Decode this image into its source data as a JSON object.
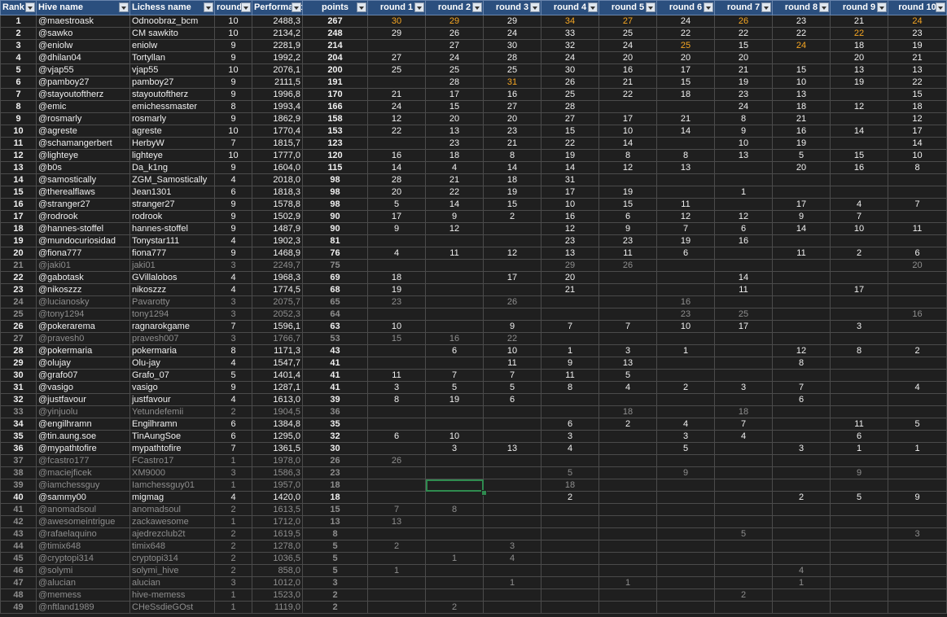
{
  "headers": {
    "rank": "Rank",
    "hive": "Hive name",
    "lichess": "Lichess name",
    "rounds": "rounds",
    "perf": "Performance",
    "points": "points",
    "round_labels": [
      "round 1",
      "round 2",
      "round 3",
      "round 4",
      "round 5",
      "round 6",
      "round 7",
      "round 8",
      "round 9",
      "round 10"
    ]
  },
  "highlight_color": "#f5a623",
  "header_bg": "#2b4f7e",
  "rows": [
    {
      "rank": "1",
      "hive": "@maestroask",
      "lichess": "Odnoobraz_bcm",
      "rounds": "10",
      "perf": "2488,3",
      "points": "267",
      "r": [
        "30",
        "29",
        "29",
        "34",
        "27",
        "24",
        "26",
        "23",
        "21",
        "24"
      ],
      "hl": [
        0,
        1,
        3,
        4,
        6,
        9
      ],
      "dim": false
    },
    {
      "rank": "2",
      "hive": "@sawko",
      "lichess": "CM sawkito",
      "rounds": "10",
      "perf": "2134,2",
      "points": "248",
      "r": [
        "29",
        "26",
        "24",
        "33",
        "25",
        "22",
        "22",
        "22",
        "22",
        "23"
      ],
      "hl": [
        8
      ],
      "dim": false
    },
    {
      "rank": "3",
      "hive": "@eniolw",
      "lichess": "eniolw",
      "rounds": "9",
      "perf": "2281,9",
      "points": "214",
      "r": [
        "",
        "27",
        "30",
        "32",
        "24",
        "25",
        "15",
        "24",
        "18",
        "19"
      ],
      "hl": [
        5,
        7
      ],
      "dim": false
    },
    {
      "rank": "4",
      "hive": "@dhilan04",
      "lichess": "Tortyllan",
      "rounds": "9",
      "perf": "1992,2",
      "points": "204",
      "r": [
        "27",
        "24",
        "28",
        "24",
        "20",
        "20",
        "20",
        "",
        "20",
        "21"
      ],
      "hl": [],
      "dim": false
    },
    {
      "rank": "5",
      "hive": "@vjap55",
      "lichess": "vjap55",
      "rounds": "10",
      "perf": "2076,1",
      "points": "200",
      "r": [
        "25",
        "25",
        "25",
        "30",
        "16",
        "17",
        "21",
        "15",
        "13",
        "13"
      ],
      "hl": [],
      "dim": false
    },
    {
      "rank": "6",
      "hive": "@pamboy27",
      "lichess": "pamboy27",
      "rounds": "9",
      "perf": "2111,5",
      "points": "191",
      "r": [
        "",
        "28",
        "31",
        "26",
        "21",
        "15",
        "19",
        "10",
        "19",
        "22"
      ],
      "hl": [
        2
      ],
      "dim": false
    },
    {
      "rank": "7",
      "hive": "@stayoutoftherz",
      "lichess": "stayoutoftherz",
      "rounds": "9",
      "perf": "1996,8",
      "points": "170",
      "r": [
        "21",
        "17",
        "16",
        "25",
        "22",
        "18",
        "23",
        "13",
        "",
        "15"
      ],
      "hl": [],
      "dim": false
    },
    {
      "rank": "8",
      "hive": "@emic",
      "lichess": "emichessmaster",
      "rounds": "8",
      "perf": "1993,4",
      "points": "166",
      "r": [
        "24",
        "15",
        "27",
        "28",
        "",
        "",
        "24",
        "18",
        "12",
        "18"
      ],
      "hl": [],
      "dim": false
    },
    {
      "rank": "9",
      "hive": "@rosmarly",
      "lichess": "rosmarly",
      "rounds": "9",
      "perf": "1862,9",
      "points": "158",
      "r": [
        "12",
        "20",
        "20",
        "27",
        "17",
        "21",
        "8",
        "21",
        "",
        "12"
      ],
      "hl": [],
      "dim": false
    },
    {
      "rank": "10",
      "hive": "@agreste",
      "lichess": "agreste",
      "rounds": "10",
      "perf": "1770,4",
      "points": "153",
      "r": [
        "22",
        "13",
        "23",
        "15",
        "10",
        "14",
        "9",
        "16",
        "14",
        "17"
      ],
      "hl": [],
      "dim": false
    },
    {
      "rank": "11",
      "hive": "@schamangerbert",
      "lichess": "HerbyW",
      "rounds": "7",
      "perf": "1815,7",
      "points": "123",
      "r": [
        "",
        "23",
        "21",
        "22",
        "14",
        "",
        "10",
        "19",
        "",
        "14"
      ],
      "hl": [],
      "dim": false
    },
    {
      "rank": "12",
      "hive": "@lighteye",
      "lichess": "lighteye",
      "rounds": "10",
      "perf": "1777,0",
      "points": "120",
      "r": [
        "16",
        "18",
        "8",
        "19",
        "8",
        "8",
        "13",
        "5",
        "15",
        "10"
      ],
      "hl": [],
      "dim": false
    },
    {
      "rank": "13",
      "hive": "@b0s",
      "lichess": "Da_k1ng",
      "rounds": "9",
      "perf": "1604,0",
      "points": "115",
      "r": [
        "14",
        "4",
        "14",
        "14",
        "12",
        "13",
        "",
        "20",
        "16",
        "8"
      ],
      "hl": [],
      "dim": false
    },
    {
      "rank": "14",
      "hive": "@samostically",
      "lichess": "ZGM_Samostically",
      "rounds": "4",
      "perf": "2018,0",
      "points": "98",
      "r": [
        "28",
        "21",
        "18",
        "31",
        "",
        "",
        "",
        "",
        "",
        ""
      ],
      "hl": [],
      "dim": false
    },
    {
      "rank": "15",
      "hive": "@therealflaws",
      "lichess": "Jean1301",
      "rounds": "6",
      "perf": "1818,3",
      "points": "98",
      "r": [
        "20",
        "22",
        "19",
        "17",
        "19",
        "",
        "1",
        "",
        "",
        ""
      ],
      "hl": [],
      "dim": false
    },
    {
      "rank": "16",
      "hive": "@stranger27",
      "lichess": "stranger27",
      "rounds": "9",
      "perf": "1578,8",
      "points": "98",
      "r": [
        "5",
        "14",
        "15",
        "10",
        "15",
        "11",
        "",
        "17",
        "4",
        "7"
      ],
      "hl": [],
      "dim": false
    },
    {
      "rank": "17",
      "hive": "@rodrook",
      "lichess": "rodrook",
      "rounds": "9",
      "perf": "1502,9",
      "points": "90",
      "r": [
        "17",
        "9",
        "2",
        "16",
        "6",
        "12",
        "12",
        "9",
        "7",
        ""
      ],
      "hl": [],
      "dim": false
    },
    {
      "rank": "18",
      "hive": "@hannes-stoffel",
      "lichess": "hannes-stoffel",
      "rounds": "9",
      "perf": "1487,9",
      "points": "90",
      "r": [
        "9",
        "12",
        "",
        "12",
        "9",
        "7",
        "6",
        "14",
        "10",
        "11"
      ],
      "hl": [],
      "dim": false
    },
    {
      "rank": "19",
      "hive": "@mundocuriosidad",
      "lichess": "Tonystar111",
      "rounds": "4",
      "perf": "1902,3",
      "points": "81",
      "r": [
        "",
        "",
        "",
        "23",
        "23",
        "19",
        "16",
        "",
        "",
        ""
      ],
      "hl": [],
      "dim": false
    },
    {
      "rank": "20",
      "hive": "@fiona777",
      "lichess": "fiona777",
      "rounds": "9",
      "perf": "1468,9",
      "points": "76",
      "r": [
        "4",
        "11",
        "12",
        "13",
        "11",
        "6",
        "",
        "11",
        "2",
        "6"
      ],
      "hl": [],
      "dim": false
    },
    {
      "rank": "21",
      "hive": "@jaki01",
      "lichess": "jaki01",
      "rounds": "3",
      "perf": "2249,7",
      "points": "75",
      "r": [
        "",
        "",
        "",
        "29",
        "26",
        "",
        "",
        "",
        "",
        "20"
      ],
      "hl": [],
      "dim": true
    },
    {
      "rank": "22",
      "hive": "@gabotask",
      "lichess": "GVillalobos",
      "rounds": "4",
      "perf": "1968,3",
      "points": "69",
      "r": [
        "18",
        "",
        "17",
        "20",
        "",
        "",
        "14",
        "",
        "",
        ""
      ],
      "hl": [],
      "dim": false
    },
    {
      "rank": "23",
      "hive": "@nikoszzz",
      "lichess": "nikoszzz",
      "rounds": "4",
      "perf": "1774,5",
      "points": "68",
      "r": [
        "19",
        "",
        "",
        "21",
        "",
        "",
        "11",
        "",
        "17",
        ""
      ],
      "hl": [],
      "dim": false
    },
    {
      "rank": "24",
      "hive": "@lucianosky",
      "lichess": "Pavarotty",
      "rounds": "3",
      "perf": "2075,7",
      "points": "65",
      "r": [
        "23",
        "",
        "26",
        "",
        "",
        "16",
        "",
        "",
        "",
        ""
      ],
      "hl": [],
      "dim": true
    },
    {
      "rank": "25",
      "hive": "@tony1294",
      "lichess": "tony1294",
      "rounds": "3",
      "perf": "2052,3",
      "points": "64",
      "r": [
        "",
        "",
        "",
        "",
        "",
        "23",
        "25",
        "",
        "",
        "16"
      ],
      "hl": [],
      "dim": true
    },
    {
      "rank": "26",
      "hive": "@pokerarema",
      "lichess": "ragnarokgame",
      "rounds": "7",
      "perf": "1596,1",
      "points": "63",
      "r": [
        "10",
        "",
        "9",
        "7",
        "7",
        "10",
        "17",
        "",
        "3",
        ""
      ],
      "hl": [],
      "dim": false
    },
    {
      "rank": "27",
      "hive": "@pravesh0",
      "lichess": "pravesh007",
      "rounds": "3",
      "perf": "1766,7",
      "points": "53",
      "r": [
        "15",
        "16",
        "22",
        "",
        "",
        "",
        "",
        "",
        "",
        ""
      ],
      "hl": [],
      "dim": true
    },
    {
      "rank": "28",
      "hive": "@pokermaria",
      "lichess": "pokermaria",
      "rounds": "8",
      "perf": "1171,3",
      "points": "43",
      "r": [
        "",
        "6",
        "10",
        "1",
        "3",
        "1",
        "",
        "12",
        "8",
        "2"
      ],
      "hl": [],
      "dim": false
    },
    {
      "rank": "29",
      "hive": "@olujay",
      "lichess": "Olu-jay",
      "rounds": "4",
      "perf": "1547,7",
      "points": "41",
      "r": [
        "",
        "",
        "11",
        "9",
        "13",
        "",
        "",
        "8",
        "",
        ""
      ],
      "hl": [],
      "dim": false
    },
    {
      "rank": "30",
      "hive": "@grafo07",
      "lichess": "Grafo_07",
      "rounds": "5",
      "perf": "1401,4",
      "points": "41",
      "r": [
        "11",
        "7",
        "7",
        "11",
        "5",
        "",
        "",
        "",
        "",
        ""
      ],
      "hl": [],
      "dim": false
    },
    {
      "rank": "31",
      "hive": "@vasigo",
      "lichess": "vasigo",
      "rounds": "9",
      "perf": "1287,1",
      "points": "41",
      "r": [
        "3",
        "5",
        "5",
        "8",
        "4",
        "2",
        "3",
        "7",
        "",
        "4"
      ],
      "hl": [],
      "dim": false
    },
    {
      "rank": "32",
      "hive": "@justfavour",
      "lichess": "justfavour",
      "rounds": "4",
      "perf": "1613,0",
      "points": "39",
      "r": [
        "8",
        "19",
        "6",
        "",
        "",
        "",
        "",
        "6",
        "",
        ""
      ],
      "hl": [],
      "dim": false
    },
    {
      "rank": "33",
      "hive": "@yinjuolu",
      "lichess": "Yetundefemii",
      "rounds": "2",
      "perf": "1904,5",
      "points": "36",
      "r": [
        "",
        "",
        "",
        "",
        "18",
        "",
        "18",
        "",
        "",
        ""
      ],
      "hl": [],
      "dim": true
    },
    {
      "rank": "34",
      "hive": "@engilhramn",
      "lichess": "Engilhramn",
      "rounds": "6",
      "perf": "1384,8",
      "points": "35",
      "r": [
        "",
        "",
        "",
        "6",
        "2",
        "4",
        "7",
        "",
        "11",
        "5"
      ],
      "hl": [],
      "dim": false
    },
    {
      "rank": "35",
      "hive": "@tin.aung.soe",
      "lichess": "TinAungSoe",
      "rounds": "6",
      "perf": "1295,0",
      "points": "32",
      "r": [
        "6",
        "10",
        "",
        "3",
        "",
        "3",
        "4",
        "",
        "6",
        ""
      ],
      "hl": [],
      "dim": false
    },
    {
      "rank": "36",
      "hive": "@mypathtofire",
      "lichess": "mypathtofire",
      "rounds": "7",
      "perf": "1361,5",
      "points": "30",
      "r": [
        "",
        "3",
        "13",
        "4",
        "",
        "5",
        "",
        "3",
        "1",
        "1"
      ],
      "hl": [],
      "dim": false
    },
    {
      "rank": "37",
      "hive": "@fcastro177",
      "lichess": "FCastro17",
      "rounds": "1",
      "perf": "1978,0",
      "points": "26",
      "r": [
        "26",
        "",
        "",
        "",
        "",
        "",
        "",
        "",
        "",
        ""
      ],
      "hl": [],
      "dim": true
    },
    {
      "rank": "38",
      "hive": "@maciejficek",
      "lichess": "XM9000",
      "rounds": "3",
      "perf": "1586,3",
      "points": "23",
      "r": [
        "",
        "",
        "",
        "5",
        "",
        "9",
        "",
        "",
        "9",
        ""
      ],
      "hl": [],
      "dim": true
    },
    {
      "rank": "39",
      "hive": "@iamchessguy",
      "lichess": "Iamchessguy01",
      "rounds": "1",
      "perf": "1957,0",
      "points": "18",
      "r": [
        "",
        "",
        "",
        "18",
        "",
        "",
        "",
        "",
        "",
        ""
      ],
      "hl": [],
      "dim": true
    },
    {
      "rank": "40",
      "hive": "@sammy00",
      "lichess": "migmag",
      "rounds": "4",
      "perf": "1420,0",
      "points": "18",
      "r": [
        "",
        "",
        "",
        "2",
        "",
        "",
        "",
        "2",
        "5",
        "9"
      ],
      "hl": [],
      "dim": false
    },
    {
      "rank": "41",
      "hive": "@anomadsoul",
      "lichess": "anomadsoul",
      "rounds": "2",
      "perf": "1613,5",
      "points": "15",
      "r": [
        "7",
        "8",
        "",
        "",
        "",
        "",
        "",
        "",
        "",
        ""
      ],
      "hl": [],
      "dim": true
    },
    {
      "rank": "42",
      "hive": "@awesomeintrigue",
      "lichess": "zackawesome",
      "rounds": "1",
      "perf": "1712,0",
      "points": "13",
      "r": [
        "13",
        "",
        "",
        "",
        "",
        "",
        "",
        "",
        "",
        ""
      ],
      "hl": [],
      "dim": true
    },
    {
      "rank": "43",
      "hive": "@rafaelaquino",
      "lichess": "ajedrezclub2t",
      "rounds": "2",
      "perf": "1619,5",
      "points": "8",
      "r": [
        "",
        "",
        "",
        "",
        "",
        "",
        "5",
        "",
        "",
        "3"
      ],
      "hl": [],
      "dim": true
    },
    {
      "rank": "44",
      "hive": "@timix648",
      "lichess": "timix648",
      "rounds": "2",
      "perf": "1278,0",
      "points": "5",
      "r": [
        "2",
        "",
        "3",
        "",
        "",
        "",
        "",
        "",
        "",
        ""
      ],
      "hl": [],
      "dim": true
    },
    {
      "rank": "45",
      "hive": "@cryptopi314",
      "lichess": "cryptopi314",
      "rounds": "2",
      "perf": "1036,5",
      "points": "5",
      "r": [
        "",
        "1",
        "4",
        "",
        "",
        "",
        "",
        "",
        "",
        ""
      ],
      "hl": [],
      "dim": true
    },
    {
      "rank": "46",
      "hive": "@solymi",
      "lichess": "solymi_hive",
      "rounds": "2",
      "perf": "858,0",
      "points": "5",
      "r": [
        "1",
        "",
        "",
        "",
        "",
        "",
        "",
        "4",
        "",
        ""
      ],
      "hl": [],
      "dim": true
    },
    {
      "rank": "47",
      "hive": "@alucian",
      "lichess": "alucian",
      "rounds": "3",
      "perf": "1012,0",
      "points": "3",
      "r": [
        "",
        "",
        "1",
        "",
        "1",
        "",
        "",
        "1",
        "",
        ""
      ],
      "hl": [],
      "dim": true
    },
    {
      "rank": "48",
      "hive": "@memess",
      "lichess": "hive-memess",
      "rounds": "1",
      "perf": "1523,0",
      "points": "2",
      "r": [
        "",
        "",
        "",
        "",
        "",
        "",
        "2",
        "",
        "",
        ""
      ],
      "hl": [],
      "dim": true
    },
    {
      "rank": "49",
      "hive": "@nftland1989",
      "lichess": "CHeSsdieGOst",
      "rounds": "1",
      "perf": "1119,0",
      "points": "2",
      "r": [
        "",
        "2",
        "",
        "",
        "",
        "",
        "",
        "",
        "",
        ""
      ],
      "hl": [],
      "dim": true
    }
  ]
}
